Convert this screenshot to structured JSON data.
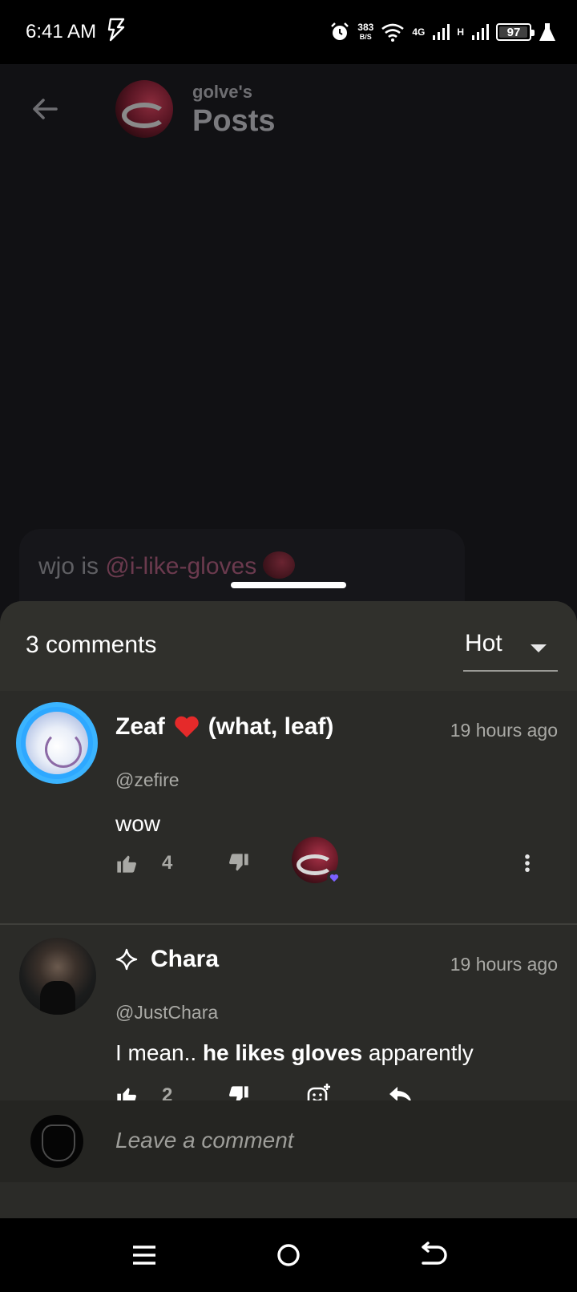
{
  "status_bar": {
    "time": "6:41 AM",
    "net_speed_value": "383",
    "net_speed_unit": "B/S",
    "network_1": "4G",
    "network_2": "H",
    "battery": "97"
  },
  "page": {
    "subtitle": "golve's",
    "title": "Posts",
    "post_text_prefix": "wjo is ",
    "post_mention": "@i-like-gloves"
  },
  "sheet": {
    "comments_count": "3 comments",
    "sort_value": "Hot"
  },
  "comments": [
    {
      "name": "Zeaf",
      "name_suffix": "(what, leaf)",
      "handle": "@zefire",
      "time": "19 hours ago",
      "body": "wow",
      "likes": "4"
    },
    {
      "name": "Chara",
      "handle": "@JustChara",
      "time": "19 hours ago",
      "body_before": "I mean.. ",
      "body_bold": "he likes gloves",
      "body_after": " apparently",
      "likes": "2"
    }
  ],
  "comment_input": {
    "placeholder": "Leave a comment"
  },
  "colors": {
    "sheet_bg": "#2b2b28",
    "heart": "#e52a2a",
    "reaction_badge": "#7b61ff"
  },
  "icons": [
    "back-arrow-icon",
    "thumbs-up-icon",
    "thumbs-down-icon",
    "more-vert-icon",
    "add-reaction-icon",
    "reply-icon",
    "sparkle-icon",
    "heart-icon",
    "menu-icon",
    "home-icon",
    "back-nav-icon"
  ]
}
